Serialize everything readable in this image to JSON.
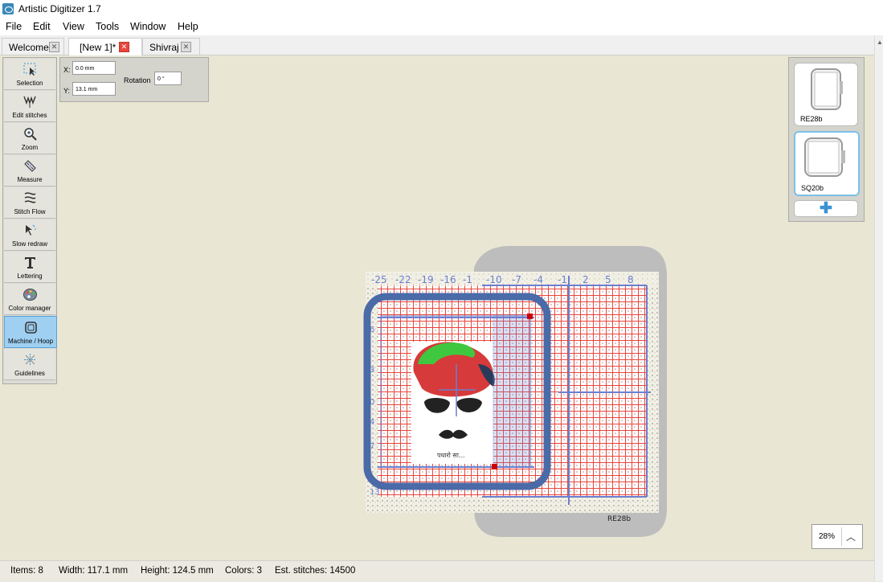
{
  "window": {
    "title": "Artistic Digitizer 1.7"
  },
  "menu": [
    "File",
    "Edit",
    "View",
    "Tools",
    "Window",
    "Help"
  ],
  "tabs": [
    {
      "label": "Welcome",
      "active": false
    },
    {
      "label": "[New 1]*",
      "active": true
    },
    {
      "label": "Shivraj",
      "active": false
    }
  ],
  "tools": [
    {
      "label": "Selection",
      "icon": "selection-arrow-icon",
      "active": false
    },
    {
      "label": "Edit stitches",
      "icon": "edit-stitches-icon",
      "active": false
    },
    {
      "label": "Zoom",
      "icon": "magnifier-icon",
      "active": false
    },
    {
      "label": "Measure",
      "icon": "ruler-icon",
      "active": false
    },
    {
      "label": "Stitch Flow",
      "icon": "stitch-flow-icon",
      "active": false
    },
    {
      "label": "Slow redraw",
      "icon": "slow-redraw-icon",
      "active": false
    },
    {
      "label": "Lettering",
      "icon": "lettering-icon",
      "active": false
    },
    {
      "label": "Color manager",
      "icon": "palette-icon",
      "active": false
    },
    {
      "label": "Machine / Hoop",
      "icon": "hoop-icon",
      "active": true
    },
    {
      "label": "Guidelines",
      "icon": "guidelines-icon",
      "active": false
    }
  ],
  "properties": {
    "x_label": "X:",
    "x_value": "0.0 mm",
    "y_label": "Y:",
    "y_value": "13.1 mm",
    "rotation_label": "Rotation",
    "rotation_value": "0 °"
  },
  "hoops": [
    {
      "label": "RE28b",
      "selected": false
    },
    {
      "label": "SQ20b",
      "selected": true
    }
  ],
  "canvas": {
    "hoop_label": "RE28b",
    "ruler_numbers": [
      "-25",
      "-22",
      "-19",
      "-16",
      "-1",
      "-10",
      "-7",
      "-4",
      "-1",
      "2",
      "5",
      "8"
    ],
    "left_ruler_numbers": [
      "6",
      "3",
      "0",
      "4",
      "7",
      "13"
    ],
    "design_caption": "पधारो सा..."
  },
  "zoom": {
    "value": "28%"
  },
  "status": {
    "items": "Items: 8",
    "width": "Width: 117.1 mm",
    "height": "Height: 124.5 mm",
    "colors": "Colors: 3",
    "stitches": "Est. stitches: 14500"
  },
  "colors": {
    "hoop_blue": "#4a6aa8",
    "grid_red": "#e8453c",
    "accent_blue": "#9fd0f2",
    "background": "#e9e6d3"
  }
}
